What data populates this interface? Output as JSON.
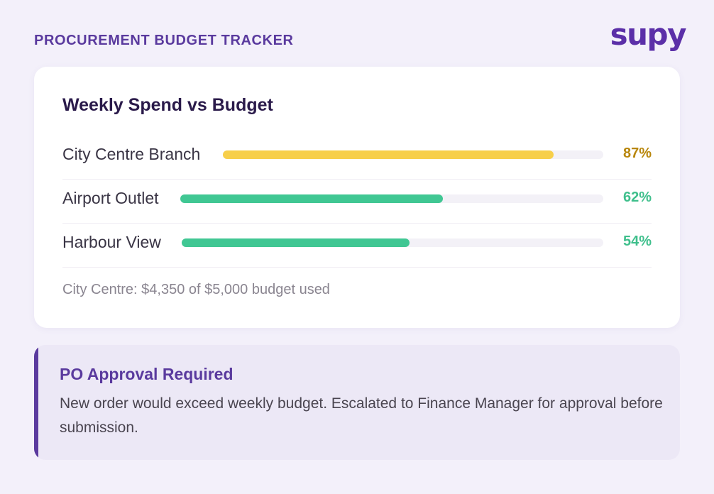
{
  "header": {
    "title": "PROCUREMENT BUDGET TRACKER",
    "logo_text": "supy"
  },
  "card": {
    "title": "Weekly Spend vs Budget",
    "rows": [
      {
        "label": "City Centre Branch",
        "percent_text": "87%",
        "percent": 87,
        "color": "#f7cf4a",
        "text_color": "#b8860b"
      },
      {
        "label": "Airport Outlet",
        "percent_text": "62%",
        "percent": 62,
        "color": "#40c793",
        "text_color": "#3fbf8c"
      },
      {
        "label": "Harbour View",
        "percent_text": "54%",
        "percent": 54,
        "color": "#40c793",
        "text_color": "#3fbf8c"
      }
    ],
    "footnote": "City Centre: $4,350 of $5,000 budget used"
  },
  "alert": {
    "title": "PO Approval Required",
    "body": "New order would exceed weekly budget. Escalated to Finance Manager for approval before submission.",
    "accent_color": "#5a3a9e"
  },
  "colors": {
    "background": "#f3f0fa",
    "brand": "#5b2fa8"
  }
}
